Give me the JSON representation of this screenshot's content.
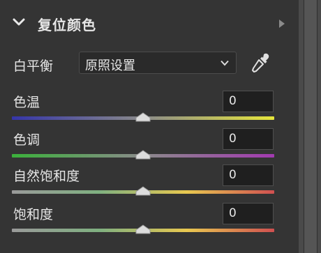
{
  "panel": {
    "title": "复位颜色"
  },
  "white_balance": {
    "label": "白平衡",
    "value": "原照设置"
  },
  "sliders": [
    {
      "label": "色温",
      "value": "0",
      "level": 0.5,
      "gradient": [
        "#3535a8",
        "#8a8a8a",
        "#e6e63c"
      ]
    },
    {
      "label": "色调",
      "value": "0",
      "level": 0.5,
      "gradient": [
        "#3bb03b",
        "#8a8a8a",
        "#a23ab0"
      ]
    },
    {
      "label": "自然饱和度",
      "value": "0",
      "level": 0.5,
      "gradient": [
        "#9a9a9a",
        "#7fb080",
        "#e8c850",
        "#d05050"
      ]
    },
    {
      "label": "饱和度",
      "value": "0",
      "level": 0.5,
      "gradient": [
        "#9a9a9a",
        "#7fb080",
        "#e8c850",
        "#d05050"
      ]
    }
  ],
  "icons": {
    "collapse": "chevron-down-icon",
    "expand": "chevron-right-icon",
    "dropdown": "chevron-down-icon",
    "eyedropper": "eyedropper-icon"
  }
}
